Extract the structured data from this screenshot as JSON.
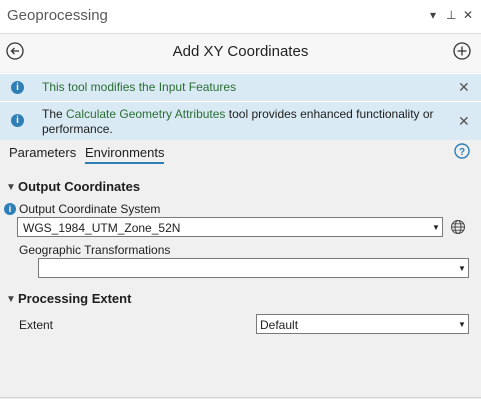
{
  "pane": {
    "title": "Geoprocessing",
    "controls": {
      "menu": "▾",
      "pin": "⊥",
      "close": "✕"
    }
  },
  "tool": {
    "title": "Add XY Coordinates",
    "back_icon": "back-arrow-icon",
    "add_icon": "add-circle-icon"
  },
  "messages": [
    {
      "text": "This tool modifies the Input Features"
    },
    {
      "text_before": "The ",
      "link": "Calculate Geometry Attributes",
      "text_after": " tool provides enhanced functionality or performance."
    }
  ],
  "tabs": {
    "parameters": "Parameters",
    "environments": "Environments",
    "active": "Environments"
  },
  "sections": {
    "output": {
      "title": "Output Coordinates",
      "ocs_label": "Output Coordinate System",
      "ocs_value": "WGS_1984_UTM_Zone_52N",
      "geo_label": "Geographic Transformations",
      "geo_value": ""
    },
    "extent": {
      "title": "Processing Extent",
      "extent_label": "Extent",
      "extent_value": "Default"
    }
  },
  "colors": {
    "accent": "#2e7fb6",
    "message_bg": "#d9eaf4",
    "message_green": "#2b6e35"
  }
}
